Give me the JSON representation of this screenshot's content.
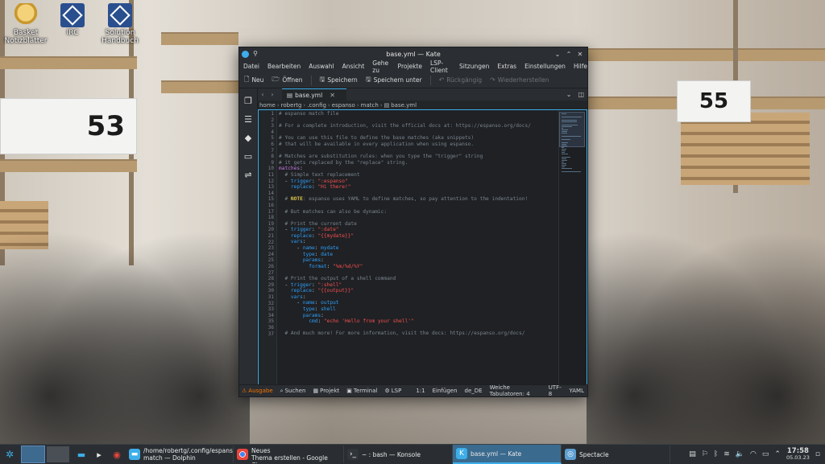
{
  "desktop": {
    "icons": [
      {
        "label": "Basket\nNotizblätter",
        "icon": "basket-icon"
      },
      {
        "label": "IRC",
        "icon": "irc-icon"
      },
      {
        "label": "Solution\nHandbuch",
        "icon": "handbook-icon"
      }
    ],
    "signs": [
      "53",
      "55"
    ]
  },
  "window": {
    "title": "base.yml — Kate",
    "menu": [
      "Datei",
      "Bearbeiten",
      "Auswahl",
      "Ansicht",
      "Gehe zu",
      "Projekte",
      "LSP-Client",
      "Sitzungen",
      "Extras",
      "Einstellungen",
      "Hilfe"
    ],
    "toolbar": {
      "new": "Neu",
      "open": "Öffnen",
      "save": "Speichern",
      "save_as": "Speichern unter",
      "undo": "Rückgängig",
      "redo": "Wiederherstellen"
    },
    "tab": {
      "name": "base.yml"
    },
    "breadcrumb": [
      "home",
      "robertg",
      ".config",
      "espanso",
      "match",
      "base.yml"
    ],
    "code": [
      [
        [
          "comment",
          "# espanso match file"
        ]
      ],
      [],
      [
        [
          "comment",
          "# For a complete introduction, visit the official docs at: https://espanso.org/docs/"
        ]
      ],
      [],
      [
        [
          "comment",
          "# You can use this file to define the base matches (aka snippets)"
        ]
      ],
      [
        [
          "comment",
          "# that will be available in every application when using espanso."
        ]
      ],
      [],
      [
        [
          "comment",
          "# Matches are substitution rules: when you type the \"trigger\" string"
        ]
      ],
      [
        [
          "comment",
          "# it gets replaced by the \"replace\" string."
        ]
      ],
      [
        [
          "top",
          "matches"
        ],
        [
          "pun",
          ":"
        ]
      ],
      [
        [
          "comment",
          "  # Simple text replacement"
        ]
      ],
      [
        [
          "pun",
          "  - "
        ],
        [
          "key",
          "trigger"
        ],
        [
          "pun",
          ": "
        ],
        [
          "str",
          "\":espanso\""
        ]
      ],
      [
        [
          "pun",
          "    "
        ],
        [
          "key",
          "replace"
        ],
        [
          "pun",
          ": "
        ],
        [
          "str",
          "\"Hi there!\""
        ]
      ],
      [],
      [
        [
          "comment",
          "  # "
        ],
        [
          "note",
          "NOTE"
        ],
        [
          "comment",
          ": espanso uses YAML to define matches, so pay attention to the indentation!"
        ]
      ],
      [],
      [
        [
          "comment",
          "  # But matches can also be dynamic:"
        ]
      ],
      [],
      [
        [
          "comment",
          "  # Print the current date"
        ]
      ],
      [
        [
          "pun",
          "  - "
        ],
        [
          "key",
          "trigger"
        ],
        [
          "pun",
          ": "
        ],
        [
          "str",
          "\":date\""
        ]
      ],
      [
        [
          "pun",
          "    "
        ],
        [
          "key",
          "replace"
        ],
        [
          "pun",
          ": "
        ],
        [
          "str",
          "\"{{mydate}}\""
        ]
      ],
      [
        [
          "pun",
          "    "
        ],
        [
          "key",
          "vars"
        ],
        [
          "pun",
          ":"
        ]
      ],
      [
        [
          "pun",
          "      - "
        ],
        [
          "key",
          "name"
        ],
        [
          "pun",
          ": "
        ],
        [
          "key",
          "mydate"
        ]
      ],
      [
        [
          "pun",
          "        "
        ],
        [
          "key",
          "type"
        ],
        [
          "pun",
          ": "
        ],
        [
          "key",
          "date"
        ]
      ],
      [
        [
          "pun",
          "        "
        ],
        [
          "key",
          "params"
        ],
        [
          "pun",
          ":"
        ]
      ],
      [
        [
          "pun",
          "          "
        ],
        [
          "key",
          "format"
        ],
        [
          "pun",
          ": "
        ],
        [
          "str",
          "\"%m/%d/%Y\""
        ]
      ],
      [],
      [
        [
          "comment",
          "  # Print the output of a shell command"
        ]
      ],
      [
        [
          "pun",
          "  - "
        ],
        [
          "key",
          "trigger"
        ],
        [
          "pun",
          ": "
        ],
        [
          "str",
          "\":shell\""
        ]
      ],
      [
        [
          "pun",
          "    "
        ],
        [
          "key",
          "replace"
        ],
        [
          "pun",
          ": "
        ],
        [
          "str",
          "\"{{output}}\""
        ]
      ],
      [
        [
          "pun",
          "    "
        ],
        [
          "key",
          "vars"
        ],
        [
          "pun",
          ":"
        ]
      ],
      [
        [
          "pun",
          "      - "
        ],
        [
          "key",
          "name"
        ],
        [
          "pun",
          ": "
        ],
        [
          "key",
          "output"
        ]
      ],
      [
        [
          "pun",
          "        "
        ],
        [
          "key",
          "type"
        ],
        [
          "pun",
          ": "
        ],
        [
          "key",
          "shell"
        ]
      ],
      [
        [
          "pun",
          "        "
        ],
        [
          "key",
          "params"
        ],
        [
          "pun",
          ":"
        ]
      ],
      [
        [
          "pun",
          "          "
        ],
        [
          "key",
          "cmd"
        ],
        [
          "pun",
          ": "
        ],
        [
          "str",
          "\"echo 'Hello from your shell'\""
        ]
      ],
      [],
      [
        [
          "comment",
          "  # And much more! For more information, visit the docs: https://espanso.org/docs/"
        ]
      ]
    ],
    "status": {
      "output": "Ausgabe",
      "search": "Suchen",
      "project": "Projekt",
      "terminal": "Terminal",
      "lsp": "LSP",
      "position": "1:1",
      "mode": "Einfügen",
      "language": "de_DE",
      "indent": "Weiche Tabulatoren: 4",
      "encoding": "UTF-8",
      "filetype": "YAML"
    }
  },
  "taskbar": {
    "tasks": [
      {
        "label": "/home/robertg/.config/espanso/\nmatch — Dolphin",
        "icon": "folder-icon",
        "active": false
      },
      {
        "label": "Linux Bibel Oesterreich - Neues\nThema erstellen - Google Chro...",
        "icon": "chrome-icon",
        "active": false
      },
      {
        "label": "~ : bash — Konsole",
        "icon": "terminal-icon",
        "active": false
      },
      {
        "label": "base.yml — Kate",
        "icon": "kate-icon",
        "active": true
      },
      {
        "label": "Spectacle",
        "icon": "spectacle-icon",
        "active": false
      }
    ],
    "clock": {
      "time": "17:58",
      "date": "05.03.23"
    }
  },
  "colors": {
    "accent": "#3daee9",
    "comment": "#7a8590",
    "key": "#2e9df7",
    "string": "#f44f4f",
    "window_bg": "#232629"
  }
}
